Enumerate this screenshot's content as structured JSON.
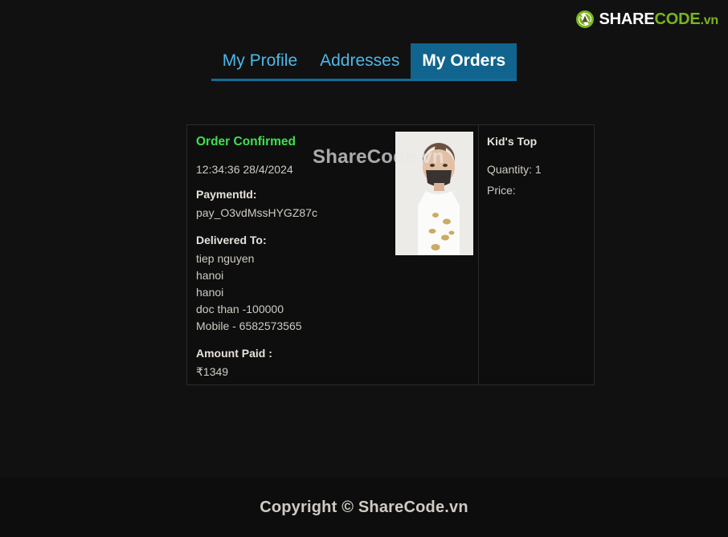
{
  "logo": {
    "icon": "recycle-circle-icon",
    "share_text": "SHARE",
    "code_text": "CODE",
    "tld_text": ".vn"
  },
  "tabs": [
    {
      "label": "My Profile",
      "active": false
    },
    {
      "label": "Addresses",
      "active": false
    },
    {
      "label": "My Orders",
      "active": true
    }
  ],
  "order": {
    "status": "Order Confirmed",
    "timestamp": "12:34:36 28/4/2024",
    "payment_id_label": "PaymentId:",
    "payment_id_value": "pay_O3vdMssHYGZ87c",
    "delivered_to_label": "Delivered To:",
    "address": [
      "tiep nguyen",
      "hanoi",
      "hanoi",
      "doc than -100000",
      "Mobile - 6582573565"
    ],
    "amount_paid_label": "Amount Paid :",
    "amount_paid_value": "₹1349"
  },
  "product": {
    "name": "Kid's Top",
    "quantity": "Quantity: 1",
    "price": "Price:",
    "image_alt": "kids-top-photo"
  },
  "watermark": {
    "card": "ShareCode.vn"
  },
  "footer": {
    "text": "Copyright © ShareCode.vn"
  },
  "colors": {
    "background": "#111111",
    "status_green": "#3fe04f",
    "tab_active_bg": "#10648e",
    "tab_inactive_text": "#4db8e8",
    "tab_underline": "#146d98",
    "logo_green": "#7ab51d",
    "text_primary": "#e6e2da",
    "text_secondary": "#cfcbc3"
  }
}
